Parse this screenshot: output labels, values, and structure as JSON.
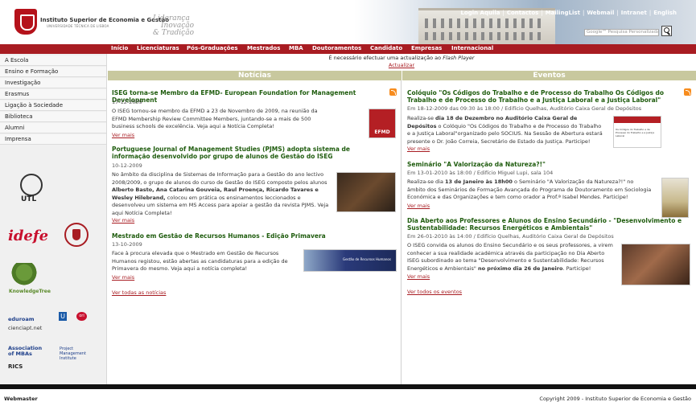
{
  "header": {
    "institution_name": "Instituto Superior de Economia e Gestão",
    "institution_sub": "UNIVERSIDADE TÉCNICA DE LISBOA",
    "motto": [
      "Liderança",
      "Inovação",
      "& Tradição"
    ],
    "top_links": [
      "Login Aquila",
      "Contactos",
      "MailingList",
      "Webmail",
      "Intranet",
      "English"
    ],
    "search_placeholder": "Google™ Pesquisa Personalizada"
  },
  "nav": {
    "items": [
      "Início",
      "Licenciaturas",
      "Pós-Graduações",
      "Mestrados",
      "MBA",
      "Doutoramentos",
      "Candidato",
      "Empresas",
      "Internacional"
    ]
  },
  "notice": {
    "text_before": "É necessário efectuar uma actualização ao",
    "flash": "Flash Player",
    "link": "Actualizar"
  },
  "sidebar": {
    "items": [
      "A Escola",
      "Ensino e Formação",
      "Investigação",
      "Erasmus",
      "Ligação à Sociedade",
      "Biblioteca",
      "Alumni",
      "Imprensa"
    ],
    "logos": {
      "utl": "UTL",
      "idefe": "idefe",
      "knowledge_tree": "KnowledgeTree",
      "eduroam": "eduroam",
      "u": "U",
      "ori": "ori",
      "cienciapt": "cienciapt.net",
      "ambas": [
        "Association",
        "of MBAs"
      ],
      "pmi": [
        "Project",
        "Management",
        "Institute"
      ],
      "rics": "RICS"
    }
  },
  "news": {
    "header": "Notícias",
    "items": [
      {
        "title": "ISEG torna-se Membro da EFMD- European Foundation for Management Development",
        "date": "17-12-2009",
        "body": "O ISEG tornou-se membro da EFMD a 23 de Novembro de 2009, na reunião da EFMD Membership Review Committee Members, juntando-se a mais de 500 business schools de excelência. Veja aqui a Notícia Completa!",
        "more": "Ver mais",
        "thumb_label": "EFMD"
      },
      {
        "title": "Portuguese Journal of Management Studies (PJMS) adopta sistema de informação desenvolvido por grupo de alunos de Gestão do ISEG",
        "date": "10-12-2009",
        "body_1": "No âmbito da disciplina de Sistemas de Informação para a Gestão do ano lectivo 2008/2009, o grupo de alunos do curso de Gestão do ISEG composto pelos alunos",
        "body_bold": "Alberto Basto, Ana Catarina Gouveia, Raul Proença, Ricardo Tavares e Wesley Hilebrand,",
        "body_2": "colocou em prática os ensinamentos leccionados e desenvolveu um sistema em MS Access para apoiar a gestão da revista PJMS. Veja aqui Notícia Completa!",
        "more": "Ver mais"
      },
      {
        "title": "Mestrado em Gestão de Recursos Humanos - Edição Primavera",
        "date": "13-10-2009",
        "body": "Face à procura elevada que o Mestrado em Gestão de Recursos Humanos registou, estão abertas as candidaturas para a edição de Primavera do mesmo. Veja aqui a notícia completa!",
        "more": "Ver mais",
        "thumb_label": "Gestão de Recursos Humanos"
      }
    ],
    "all_link": "Ver todas as notícias"
  },
  "events": {
    "header": "Eventos",
    "items": [
      {
        "title": "Colóquio \"Os Códigos do Trabalho e de Processo do Trabalho Os Códigos do Trabalho e de Processo do Trabalho e a Justiça Laboral e a Justiça Laboral\"",
        "date": "Em 18-12-2009 das 09:30 às 18:00 / Edifício Quelhas, Auditório Caixa Geral de Depósitos",
        "body_1": "Realiza-se",
        "body_bold": "dia 18 de Dezembro no Auditório Caixa Geral de Depósitos",
        "body_2": "o Colóquio \"Os Códigos do Trabalho e de Processo do Trabalho e a Justiça Laboral\"organizado pelo SOCIUS. Na Sessão de Abertura estará presente o Dr. João Correia, Secretário de Estado da Justiça. Participe!",
        "more": "Ver mais",
        "thumb_label": "Os Códigos do Trabalho e de Processo do Trabalho e a Justiça Laboral"
      },
      {
        "title": "Seminário \"A Valorização da Natureza?!\"",
        "date": "Em 13-01-2010 às 18:00 / Edifício Miguel Lupi, sala 104",
        "body_1": "Realiza-se dia",
        "body_bold": "13 de Janeiro às 18h00",
        "body_2": "o Seminário \"A Valorização da Natureza?!\" no âmbito dos Seminários de Formação Avançada do Programa de Doutoramento em Sociologia Económica e das Organizações e tem como orador a Prof.ª Isabel Mendes. Participe!",
        "more": "Ver mais"
      },
      {
        "title": "Dia Aberto aos Professores e Alunos do Ensino Secundário - \"Desenvolvimento e Sustentabilidade: Recursos Energéticos e Ambientais\"",
        "date": "Em 26-01-2010 às 14:00 / Edifício Quelhas, Auditório Caixa Geral de Depósitos",
        "body_1": "O ISEG convida os alunos do Ensino Secundário e os seus professores, a virem conhecer a sua realidade académica através da participação no Dia Aberto ISEG subordinado ao tema \"Desenvolvimento e Sustentabilidade: Recursos Energéticos e Ambientais\"",
        "body_bold": "no próximo dia 26 de Janeiro",
        "body_2": ". Participe!",
        "more": "Ver mais"
      }
    ],
    "all_link": "Ver todos os eventos"
  },
  "footer": {
    "left": "Webmaster",
    "right": "Copyright 2009 - Instituto Superior de Economia e Gestão"
  },
  "colors": {
    "brand_red": "#a81c22",
    "title_green": "#1f5c0e",
    "column_header": "#c8c89e"
  }
}
